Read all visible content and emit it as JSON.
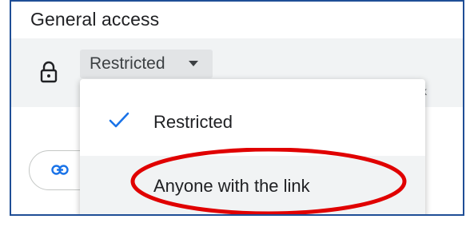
{
  "section": {
    "title": "General access"
  },
  "access": {
    "icon": "lock-icon",
    "dropdown": {
      "selected": "Restricted",
      "icon": "caret-down-icon"
    },
    "obscured_text": "k"
  },
  "menu": {
    "items": [
      {
        "label": "Restricted",
        "selected": true,
        "icon": "check-icon"
      },
      {
        "label": "Anyone with the link",
        "selected": false,
        "hovered": true
      }
    ]
  },
  "copy_link": {
    "icon": "link-icon"
  },
  "colors": {
    "accent": "#1a73e8",
    "annotation": "#e00000",
    "frame_border": "#1f4e96",
    "row_background": "#f1f3f4"
  }
}
